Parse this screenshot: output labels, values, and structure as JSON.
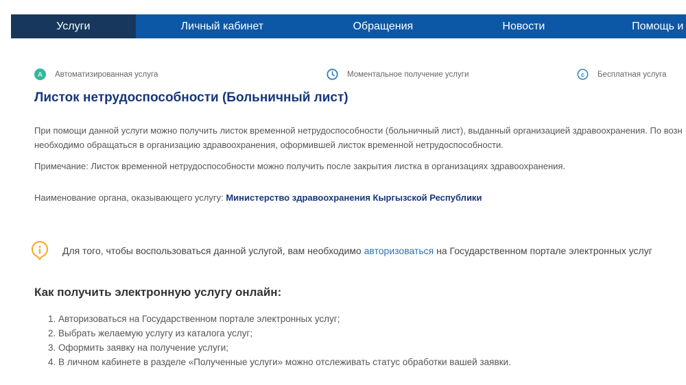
{
  "nav": {
    "items": [
      "Услуги",
      "Личный кабинет",
      "Обращения",
      "Новости",
      "Помощь и"
    ],
    "active_index": 0
  },
  "features": [
    {
      "icon": "letter-a-circle-icon",
      "label": "Автоматизированная услуга",
      "color": "#34b89a"
    },
    {
      "icon": "clock-icon",
      "label": "Моментальное получение услуги",
      "color": "#2c7fb8"
    },
    {
      "icon": "currency-circle-icon",
      "label": "Бесплатная услуга",
      "color": "#2c7fb8"
    }
  ],
  "service": {
    "title": "Листок нетрудоспособности (Больничный лист)",
    "description_line1": "При помощи данной услуги можно получить листок временной нетрудоспособности (больничный лист), выданный организацией здравоохранения. По возн",
    "description_line2": "необходимо обращаться в организацию здравоохранения, оформившей листок временной нетрудоспособности.",
    "note": "Примечание: Листок временной нетрудоспособности можно получить после закрытия листка в организациях здравоохранения.",
    "org_label": "Наименование органа, оказывающего услугу: ",
    "org_name": "Министерство здравоохранения Кыргызской Республики"
  },
  "info": {
    "icon": "info-icon",
    "text_before": "Для того, чтобы воспользоваться данной услугой, вам необходимо ",
    "link": "авторизоваться",
    "text_after": " на Государственном портале электронных услуг",
    "icon_color": "#f5a623"
  },
  "how": {
    "title": "Как получить электронную услугу онлайн:",
    "steps": [
      "1. Авторизоваться на Государственном портале электронных услуг;",
      "2. Выбрать желаемую услугу из каталога услуг;",
      "3. Оформить заявку на получение услуги;",
      "4. В личном кабинете в разделе «Полученные услуги» можно отслеживать статус обработки вашей заявки."
    ]
  },
  "colors": {
    "nav_bg": "#0d58a6",
    "nav_active_bg": "#17385c",
    "title": "#16377a",
    "link": "#2f6fb6"
  }
}
